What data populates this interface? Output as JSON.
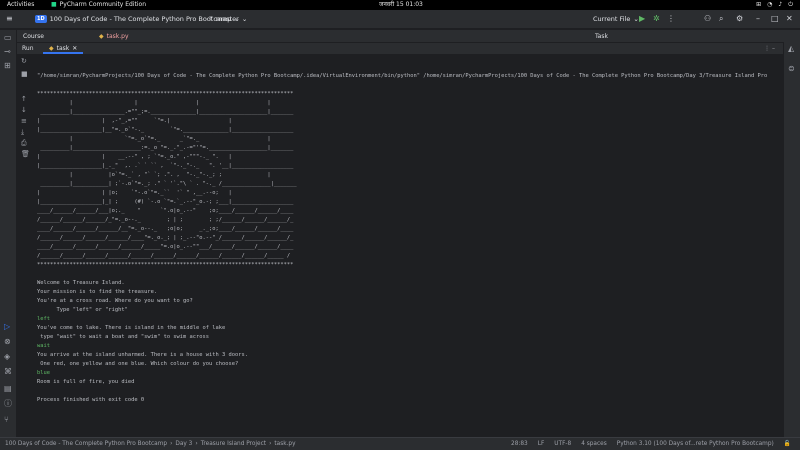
{
  "system_bar": {
    "activities": "Activities",
    "app_name": "PyCharm Community Edition",
    "clock": "जनवरी 15  01:03"
  },
  "titlebar": {
    "project_badge": "1D",
    "project_name": "100 Days of Code - The Complete Python Pro Bootcamp",
    "branch": "master",
    "run_config": "Current File"
  },
  "tabs": {
    "course": "Course",
    "editor_file": "task.py",
    "right_panel": "Task"
  },
  "run_panel": {
    "label": "Run",
    "tab": "task"
  },
  "console": {
    "lines": [
      {
        "text": "\"/home/simran/PycharmProjects/100 Days of Code - The Complete Python Pro Bootcamp/.idea/VirtualEnvironment/bin/python\" /home/simran/PycharmProjects/100 Days of Code - The Complete Python Pro Bootcamp/Day 3/Treasure Island Pro",
        "type": "out"
      },
      {
        "text": "",
        "type": "out"
      },
      {
        "text": "*******************************************************************************",
        "type": "out"
      },
      {
        "text": "          |                   |                  |                     |",
        "type": "out"
      },
      {
        "text": " _________|________________.=\"\"_;=.______________|_____________________|_______",
        "type": "out"
      },
      {
        "text": "|                   |  ,-\"_,=\"\"     `\"=.|                  |",
        "type": "out"
      },
      {
        "text": "|___________________|__\"=._o`\"-._        `\"=.______________|___________________",
        "type": "out"
      },
      {
        "text": "          |                `\"=._o`\"=._      _`\"=._                     |",
        "type": "out"
      },
      {
        "text": " _________|_____________________:=._o \"=._.\"_.-=\"'\"=.__________________|_______",
        "type": "out"
      },
      {
        "text": "|                   |    __.--\" , ; `\"=._o.\" ,-\"\"\"-._ \".   |",
        "type": "out"
      },
      {
        "text": "|___________________|_._\"  ,. .` ` `` ,  `\"-._\"-._   \". '__|___________________",
        "type": "out"
      },
      {
        "text": "          |           |o`\"=._` , \"` `; .\". ,  \"-._\"-._; ;              |",
        "type": "out"
      },
      {
        "text": " _________|___________| ;`-.o`\"=._; .\" ` '`.\"\\ ` . \"-._ /_______________|_______",
        "type": "out"
      },
      {
        "text": "|                   | |o;    `\"-.o`\"=._``  '` \" ,__.--o;   |",
        "type": "out"
      },
      {
        "text": "|___________________|_| ;     (#) `-.o `\"=.`_.--\"_o.-; ;___|___________________",
        "type": "out"
      },
      {
        "text": "____/______/______/___|o;._    \"      `\".o|o_.--\"    ;o;____/______/______/____",
        "type": "out"
      },
      {
        "text": "/______/______/______/_\"=._o--._        ; | ;        ; ;/______/______/______/_",
        "type": "out"
      },
      {
        "text": "____/______/______/______/__\"=._o--._   ;o|o;     _._;o;____/______/______/____",
        "type": "out"
      },
      {
        "text": "/______/______/______/______/____\"=._o._; | ;_.--\"o.--\"_/______/______/______/_",
        "type": "out"
      },
      {
        "text": "____/______/______/______/______/_____\"=.o|o_.--\"\"___/______/______/______/____",
        "type": "out"
      },
      {
        "text": "/______/______/______/______/______/______/______/______/______/______/_____ /",
        "type": "out"
      },
      {
        "text": "*******************************************************************************",
        "type": "out"
      },
      {
        "text": "",
        "type": "out"
      },
      {
        "text": "Welcome to Treasure Island.",
        "type": "out"
      },
      {
        "text": "Your mission is to find the treasure.",
        "type": "out"
      },
      {
        "text": "You're at a cross road. Where do you want to go?",
        "type": "out"
      },
      {
        "text": "      Type \"left\" or \"right\"",
        "type": "out"
      },
      {
        "text": "left",
        "type": "in"
      },
      {
        "text": "You've come to lake. There is island in the middle of lake",
        "type": "out"
      },
      {
        "text": " type \"wait\" to wait a boat and \"swim\" to swim across",
        "type": "out"
      },
      {
        "text": "wait",
        "type": "in"
      },
      {
        "text": "You arrive at the island unharmed. There is a house with 3 doors.",
        "type": "out"
      },
      {
        "text": " One red, one yellow and one blue. Which colour do you choose?",
        "type": "out"
      },
      {
        "text": "blue",
        "type": "in"
      },
      {
        "text": "Room is full of fire, you died",
        "type": "out"
      },
      {
        "text": "",
        "type": "out"
      },
      {
        "text": "Process finished with exit code 0",
        "type": "out"
      }
    ]
  },
  "statusbar": {
    "crumbs": [
      "100 Days of Code - The Complete Python Pro Bootcamp",
      "Day 3",
      "Treasure Island Project",
      "task.py"
    ],
    "position": "28:83",
    "line_sep": "LF",
    "encoding": "UTF-8",
    "indent": "4 spaces",
    "interpreter": "Python 3.10 (100 Days of...rete Python Pro Bootcamp)"
  },
  "colors": {
    "accent": "#3574f0",
    "user_input": "#5fb865",
    "background": "#1e1f22",
    "panel": "#2b2d30"
  },
  "icons": [
    "grid-icon",
    "volume-icon",
    "wifi-icon",
    "power-icon",
    "play-icon",
    "debug-icon",
    "stop-icon",
    "user-icon",
    "search-icon",
    "settings-icon"
  ]
}
